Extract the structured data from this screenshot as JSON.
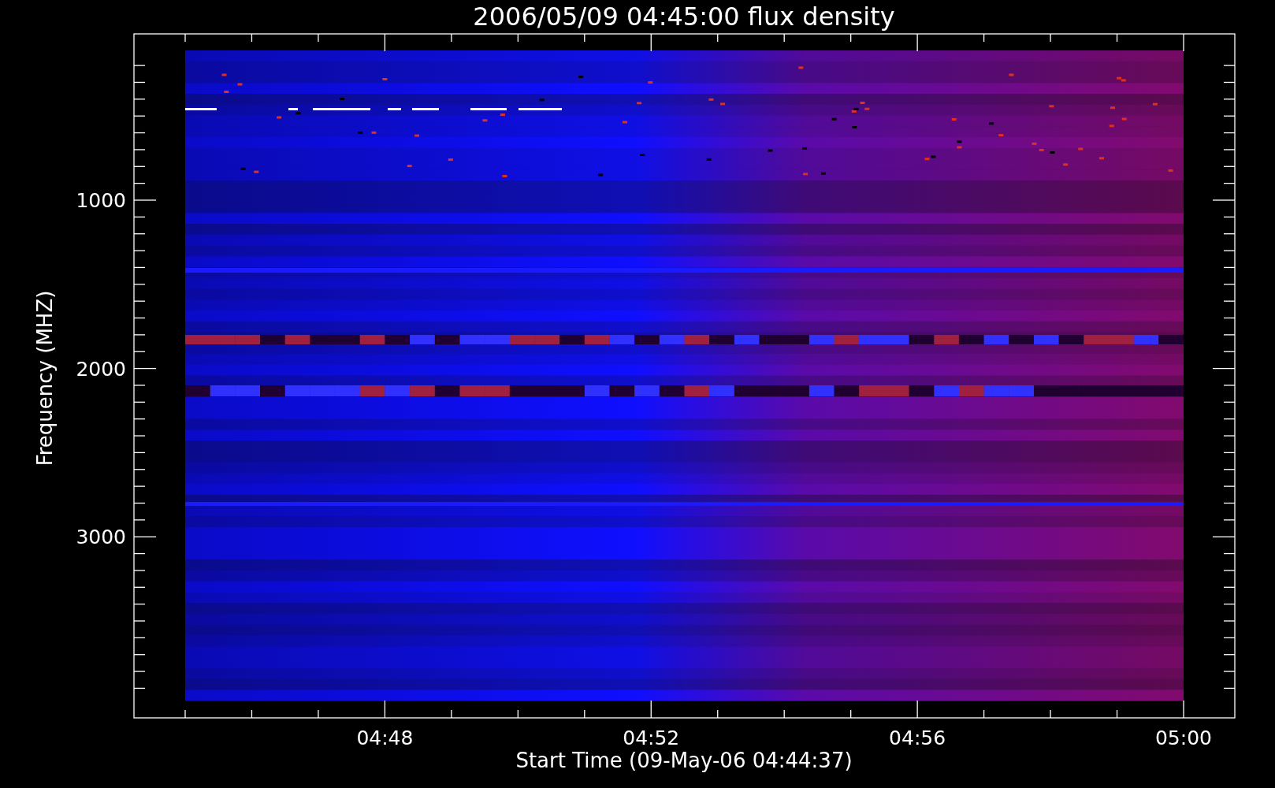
{
  "chart": {
    "title": "2006/05/09 04:45:00 flux density",
    "xlabel": "Start Time (09-May-06 04:44:37)",
    "ylabel": "Frequency (MHZ)",
    "xtick_labels": [
      "04:48",
      "04:52",
      "04:56",
      "05:00"
    ],
    "ytick_labels": [
      "1000",
      "2000",
      "3000"
    ]
  }
}
